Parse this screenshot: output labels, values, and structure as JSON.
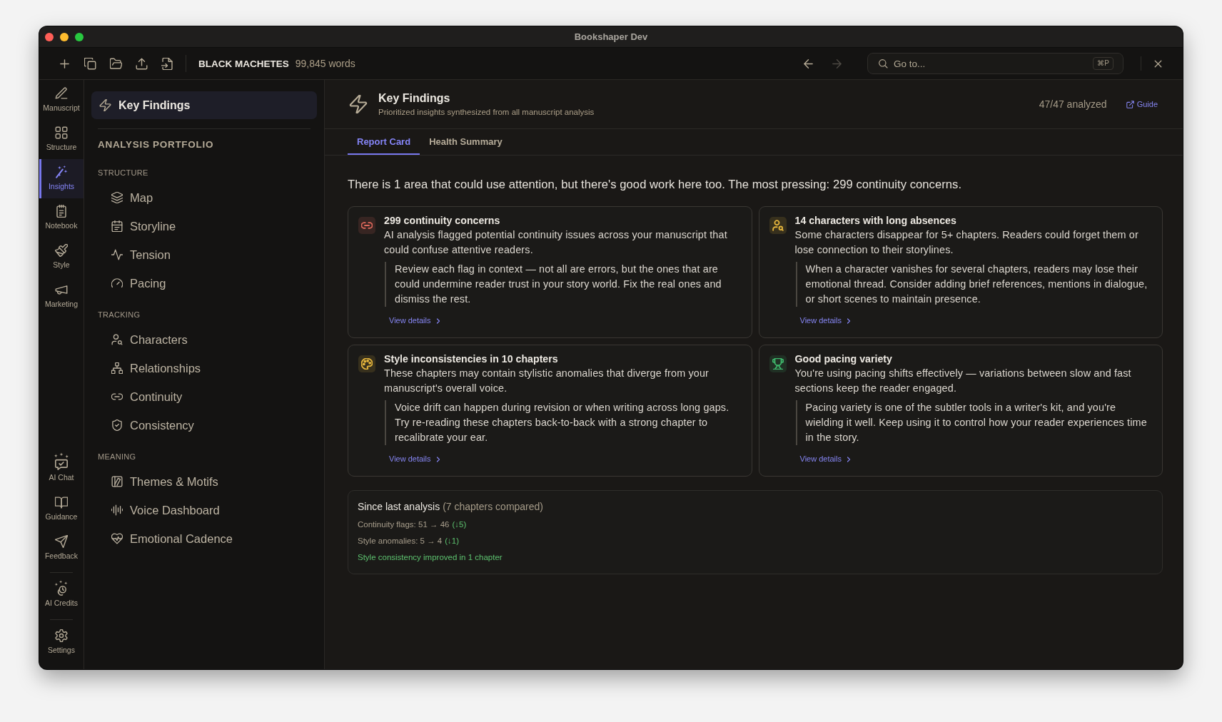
{
  "window": {
    "title": "Bookshaper Dev"
  },
  "toolbar": {
    "project": "BLACK MACHETES",
    "word_count": "99,845 words",
    "back": {
      "disabled": false
    },
    "forward": {
      "disabled": true
    },
    "search": {
      "placeholder": "Go to...",
      "shortcut": "⌘P"
    }
  },
  "rail": {
    "items": [
      {
        "label": "Manuscript",
        "selected": false
      },
      {
        "label": "Structure",
        "selected": false
      },
      {
        "label": "Insights",
        "selected": true
      },
      {
        "label": "Notebook",
        "selected": false
      },
      {
        "label": "Style",
        "selected": false
      },
      {
        "label": "Marketing",
        "selected": false
      }
    ],
    "bottom_groups": [
      {
        "items": [
          {
            "label": "AI Chat",
            "selected": false
          },
          {
            "label": "Guidance",
            "selected": false
          },
          {
            "label": "Feedback",
            "selected": false
          }
        ]
      },
      {
        "items": [
          {
            "label": "AI Credits",
            "selected": false
          }
        ]
      },
      {
        "items": [
          {
            "label": "Settings",
            "selected": false
          }
        ]
      }
    ]
  },
  "sidebar": {
    "top_item": {
      "label": "Key Findings",
      "selected": true
    },
    "title": "ANALYSIS PORTFOLIO",
    "sections": [
      {
        "heading": "STRUCTURE",
        "items": [
          {
            "label": "Map",
            "selected": false
          },
          {
            "label": "Storyline",
            "selected": false
          },
          {
            "label": "Tension",
            "selected": false
          },
          {
            "label": "Pacing",
            "selected": false
          }
        ]
      },
      {
        "heading": "TRACKING",
        "items": [
          {
            "label": "Characters",
            "selected": false
          },
          {
            "label": "Relationships",
            "selected": false
          },
          {
            "label": "Continuity",
            "selected": false
          },
          {
            "label": "Consistency",
            "selected": false
          }
        ]
      },
      {
        "heading": "MEANING",
        "items": [
          {
            "label": "Themes & Motifs",
            "selected": false
          },
          {
            "label": "Voice Dashboard",
            "selected": false
          },
          {
            "label": "Emotional Cadence",
            "selected": false
          }
        ]
      }
    ]
  },
  "header": {
    "title": "Key Findings",
    "subtitle": "Prioritized insights synthesized from all manuscript analysis",
    "status": "47/47 analyzed",
    "guide_link": "Guide"
  },
  "tabs": [
    {
      "label": "Report Card",
      "selected": true
    },
    {
      "label": "Health Summary",
      "selected": false
    }
  ],
  "summary": "There is 1 area that could use attention, but there's good work here too. The most pressing: 299 continuity concerns.",
  "findings": [
    {
      "color": "#e0695c",
      "title": "299 continuity concerns",
      "description": "AI analysis flagged potential continuity issues across your manuscript that could confuse attentive readers.",
      "advice": "Review each flag in context — not all are errors, but the ones that are could undermine reader trust in your story world. Fix the real ones and dismiss the rest.",
      "link": "View details"
    },
    {
      "color": "#e5b53c",
      "title": "14 characters with long absences",
      "description": "Some characters disappear for 5+ chapters. Readers could forget them or lose connection to their storylines.",
      "advice": "When a character vanishes for several chapters, readers may lose their emotional thread. Consider adding brief references, mentions in dialogue, or short scenes to maintain presence.",
      "link": "View details"
    },
    {
      "color": "#e5b53c",
      "title": "Style inconsistencies in 10 chapters",
      "description": "These chapters may contain stylistic anomalies that diverge from your manuscript's overall voice.",
      "advice": "Voice drift can happen during revision or when writing across long gaps. Try re-reading these chapters back-to-back with a strong chapter to recalibrate your ear.",
      "link": "View details"
    },
    {
      "color": "#3fb66b",
      "title": "Good pacing variety",
      "description": "You're using pacing shifts effectively — variations between slow and fast sections keep the reader engaged.",
      "advice": "Pacing variety is one of the subtler tools in a writer's kit, and you're wielding it well. Keep using it to control how your reader experiences time in the story.",
      "link": "View details"
    }
  ],
  "changes": {
    "title": "Since last analysis",
    "detail": "(7 chapters compared)",
    "metrics": [
      {
        "text": "Continuity flags: 51 → 46",
        "delta": "(↓5)"
      },
      {
        "text": "Style anomalies: 5 → 4",
        "delta": "(↓1)"
      }
    ],
    "note": "Style consistency improved in 1 chapter"
  }
}
